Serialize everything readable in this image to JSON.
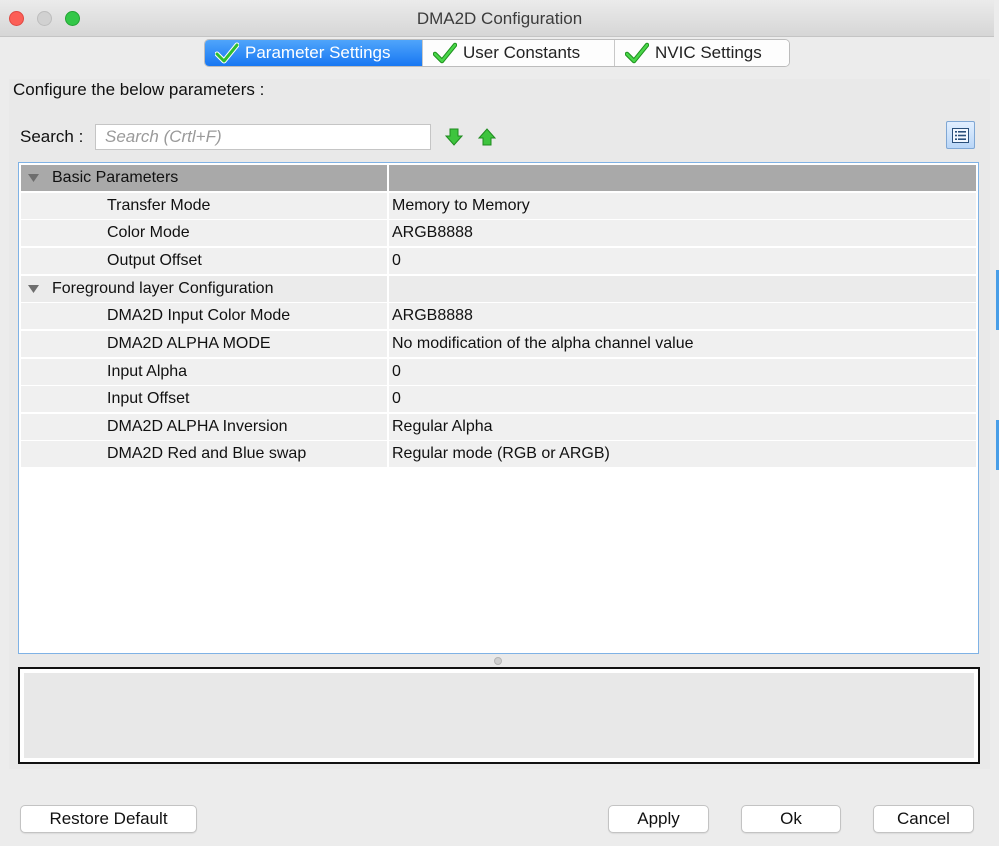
{
  "window": {
    "title": "DMA2D Configuration"
  },
  "tabs": [
    {
      "label": "Parameter Settings",
      "active": true,
      "icon": "check-icon"
    },
    {
      "label": "User Constants",
      "active": false,
      "icon": "check-icon"
    },
    {
      "label": "NVIC Settings",
      "active": false,
      "icon": "check-icon"
    }
  ],
  "configure_label": "Configure the below parameters :",
  "search": {
    "label": "Search :",
    "placeholder": "Search (Crtl+F)",
    "value": ""
  },
  "table": {
    "groups": [
      {
        "label": "Basic Parameters",
        "rows": [
          {
            "name": "Transfer Mode",
            "value": "Memory to Memory"
          },
          {
            "name": "Color Mode",
            "value": "ARGB8888"
          },
          {
            "name": "Output Offset",
            "value": "0"
          }
        ]
      },
      {
        "label": "Foreground layer Configuration",
        "rows": [
          {
            "name": "DMA2D Input Color Mode",
            "value": "ARGB8888"
          },
          {
            "name": "DMA2D ALPHA MODE",
            "value": "No modification of the alpha channel value"
          },
          {
            "name": "Input Alpha",
            "value": "0"
          },
          {
            "name": "Input Offset",
            "value": "0"
          },
          {
            "name": "DMA2D ALPHA Inversion",
            "value": "Regular Alpha"
          },
          {
            "name": "DMA2D Red and Blue swap",
            "value": "Regular mode (RGB or ARGB)"
          }
        ]
      }
    ]
  },
  "buttons": {
    "restore": "Restore Default",
    "apply": "Apply",
    "ok": "Ok",
    "cancel": "Cancel"
  },
  "colors": {
    "active_tab": "#1877f2",
    "check": "#2fbf2f",
    "table_border": "#7fb2e5",
    "group_header": "#a9a9a9"
  }
}
